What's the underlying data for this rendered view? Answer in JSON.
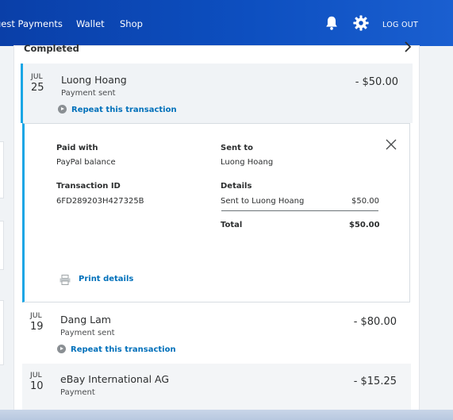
{
  "header": {
    "nav": [
      "uest Payments",
      "Wallet",
      "Shop"
    ],
    "logout_label": "LOG OUT",
    "icons": [
      "bell-icon",
      "gear-icon"
    ]
  },
  "section": {
    "title": "Completed"
  },
  "transactions": [
    {
      "month": "JUL",
      "day": "25",
      "name": "Luong Hoang",
      "type": "Payment sent",
      "amount": "- $50.00",
      "repeat_label": "Repeat this transaction"
    },
    {
      "month": "JUL",
      "day": "19",
      "name": "Dang Lam",
      "type": "Payment sent",
      "amount": "- $80.00",
      "repeat_label": "Repeat this transaction"
    },
    {
      "month": "JUL",
      "day": "10",
      "name": "eBay International AG",
      "type": "Payment",
      "amount": "- $15.25"
    }
  ],
  "details": {
    "paid_with_label": "Paid with",
    "paid_with_value": "PayPal balance",
    "sent_to_label": "Sent to",
    "sent_to_value": "Luong Hoang",
    "transaction_id_label": "Transaction ID",
    "transaction_id_value": "6FD289203H427325B",
    "details_label": "Details",
    "line_item_label": "Sent to Luong Hoang",
    "line_item_amount": "$50.00",
    "total_label": "Total",
    "total_amount": "$50.00",
    "print_label": "Print details"
  },
  "colors": {
    "header_blue": "#0d4fc0",
    "accent_cyan": "#1aa6e5",
    "link_blue": "#0070ba"
  }
}
